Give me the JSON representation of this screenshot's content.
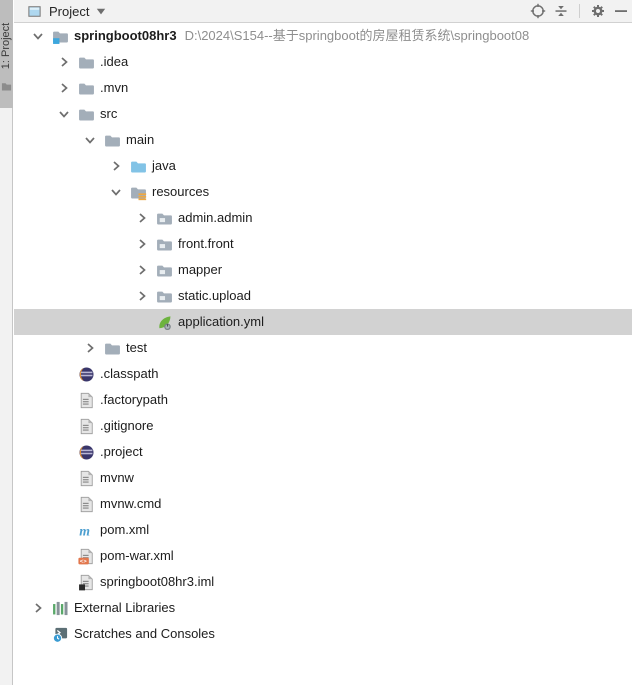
{
  "stripe": {
    "tab_label": "1: Project"
  },
  "toolbar": {
    "title": "Project",
    "icons": {
      "tool_window": "project-tool-window-icon",
      "locate": "select-opened-file-icon",
      "collapse_all": "collapse-all-icon",
      "settings": "settings-gear-icon",
      "hide": "hide-panel-icon"
    }
  },
  "colors": {
    "selection_bg": "#D2D2D2",
    "tree_bg": "#FFFFFF",
    "toolbar_bg": "#F2F2F2",
    "stripe_tab_bg": "#BDBDBD",
    "path_text": "#8E8E8E",
    "folder_gray": "#A3AEB9",
    "java_folder_blue": "#82C3E6",
    "root_badge_blue": "#3DA7DD",
    "resources_yellow": "#EFA842",
    "spring_green": "#6DB33F",
    "maven_blue": "#4D9FD0",
    "eclipse_orange": "#F7941E",
    "war_badge_orange": "#E2774D",
    "library_green": "#59A869"
  },
  "tree": {
    "rows": [
      {
        "label": "springboot08hr3",
        "path": "D:\\2024\\S154--基于springboot的房屋租赁系统\\springboot08",
        "level": 0,
        "icon": "project-root-folder",
        "state": "expanded",
        "bold": true
      },
      {
        "label": ".idea",
        "level": 1,
        "icon": "folder",
        "state": "collapsed"
      },
      {
        "label": ".mvn",
        "level": 1,
        "icon": "folder",
        "state": "collapsed"
      },
      {
        "label": "src",
        "level": 1,
        "icon": "folder",
        "state": "expanded"
      },
      {
        "label": "main",
        "level": 2,
        "icon": "folder",
        "state": "expanded"
      },
      {
        "label": "java",
        "level": 3,
        "icon": "source-folder",
        "state": "collapsed"
      },
      {
        "label": "resources",
        "level": 3,
        "icon": "resources-folder",
        "state": "expanded"
      },
      {
        "label": "admin.admin",
        "level": 4,
        "icon": "package-folder",
        "state": "collapsed"
      },
      {
        "label": "front.front",
        "level": 4,
        "icon": "package-folder",
        "state": "collapsed"
      },
      {
        "label": "mapper",
        "level": 4,
        "icon": "package-folder",
        "state": "collapsed"
      },
      {
        "label": "static.upload",
        "level": 4,
        "icon": "package-folder",
        "state": "collapsed"
      },
      {
        "label": "application.yml",
        "level": 4,
        "icon": "spring-config-file",
        "state": "leaf",
        "selected": true
      },
      {
        "label": "test",
        "level": 2,
        "icon": "folder",
        "state": "collapsed"
      },
      {
        "label": ".classpath",
        "level": 1,
        "icon": "eclipse-file",
        "state": "leaf"
      },
      {
        "label": ".factorypath",
        "level": 1,
        "icon": "text-file",
        "state": "leaf"
      },
      {
        "label": ".gitignore",
        "level": 1,
        "icon": "text-file",
        "state": "leaf"
      },
      {
        "label": ".project",
        "level": 1,
        "icon": "eclipse-file",
        "state": "leaf"
      },
      {
        "label": "mvnw",
        "level": 1,
        "icon": "text-file",
        "state": "leaf"
      },
      {
        "label": "mvnw.cmd",
        "level": 1,
        "icon": "text-file",
        "state": "leaf"
      },
      {
        "label": "pom.xml",
        "level": 1,
        "icon": "maven-file",
        "state": "leaf"
      },
      {
        "label": "pom-war.xml",
        "level": 1,
        "icon": "xml-file",
        "state": "leaf"
      },
      {
        "label": "springboot08hr3.iml",
        "level": 1,
        "icon": "module-file",
        "state": "leaf"
      },
      {
        "label": "External Libraries",
        "level": 0,
        "icon": "libraries",
        "state": "collapsed"
      },
      {
        "label": "Scratches and Consoles",
        "level": 0,
        "icon": "scratches",
        "state": "leaf"
      }
    ]
  }
}
